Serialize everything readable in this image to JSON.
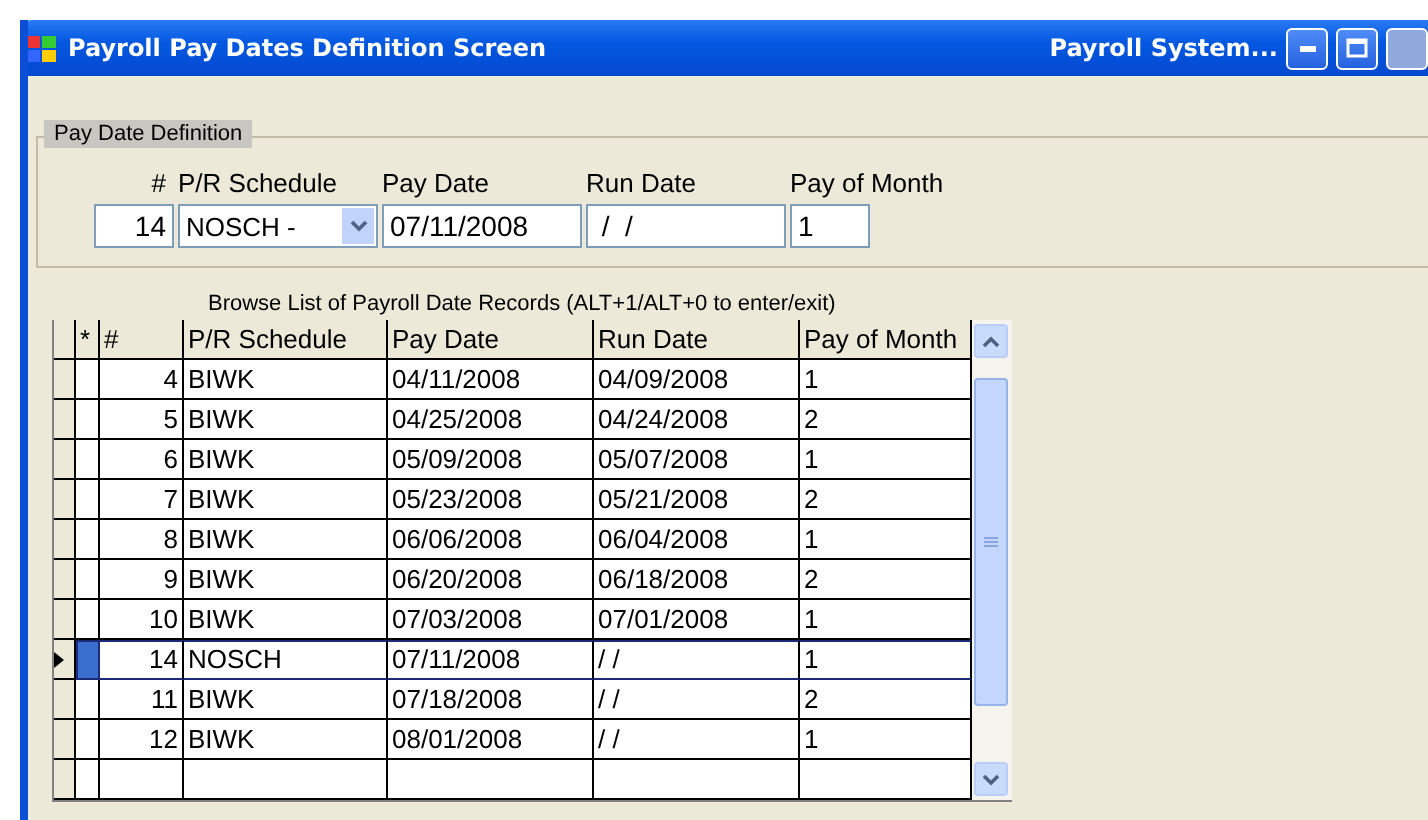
{
  "window": {
    "title": "Payroll Pay Dates Definition Screen",
    "app_title": "Payroll System..."
  },
  "definition": {
    "legend": "Pay Date Definition",
    "fields": [
      {
        "label": "#",
        "value": "14",
        "kind": "number"
      },
      {
        "label": "P/R Schedule",
        "value": "NOSCH - ",
        "kind": "select"
      },
      {
        "label": "Pay Date",
        "value": "07/11/2008",
        "kind": "date"
      },
      {
        "label": "Run Date",
        "value": " /  /",
        "kind": "text"
      },
      {
        "label": "Pay of Month",
        "value": "1",
        "kind": "short"
      }
    ]
  },
  "grid": {
    "caption": "Browse List of Payroll Date Records (ALT+1/ALT+0 to enter/exit)",
    "marker_header": "*",
    "columns": [
      "#",
      "P/R Schedule",
      "Pay Date",
      "Run Date",
      "Pay of Month"
    ],
    "rows": [
      {
        "cells": [
          "4",
          "BIWK",
          "04/11/2008",
          "04/09/2008",
          "1"
        ],
        "selected": false
      },
      {
        "cells": [
          "5",
          "BIWK",
          "04/25/2008",
          "04/24/2008",
          "2"
        ],
        "selected": false
      },
      {
        "cells": [
          "6",
          "BIWK",
          "05/09/2008",
          "05/07/2008",
          "1"
        ],
        "selected": false
      },
      {
        "cells": [
          "7",
          "BIWK",
          "05/23/2008",
          "05/21/2008",
          "2"
        ],
        "selected": false
      },
      {
        "cells": [
          "8",
          "BIWK",
          "06/06/2008",
          "06/04/2008",
          "1"
        ],
        "selected": false
      },
      {
        "cells": [
          "9",
          "BIWK",
          "06/20/2008",
          "06/18/2008",
          "2"
        ],
        "selected": false
      },
      {
        "cells": [
          "10",
          "BIWK",
          "07/03/2008",
          "07/01/2008",
          "1"
        ],
        "selected": false
      },
      {
        "cells": [
          "14",
          "NOSCH",
          "07/11/2008",
          "/ /",
          "1"
        ],
        "selected": true
      },
      {
        "cells": [
          "11",
          "BIWK",
          "07/18/2008",
          "/ /",
          "2"
        ],
        "selected": false
      },
      {
        "cells": [
          "12",
          "BIWK",
          "08/01/2008",
          "/ /",
          "1"
        ],
        "selected": false
      }
    ]
  }
}
